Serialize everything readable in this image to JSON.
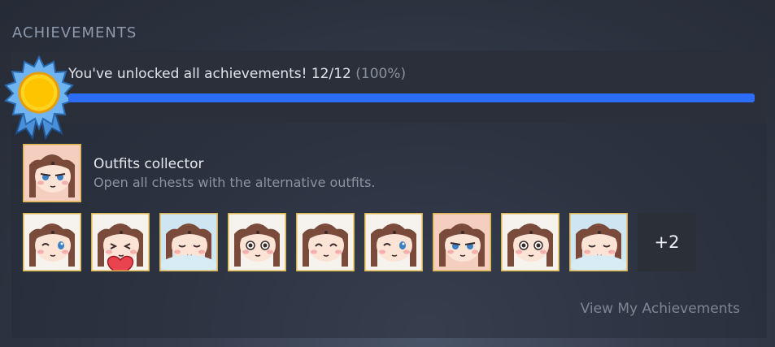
{
  "section_title": "ACHIEVEMENTS",
  "progress": {
    "message": "You've unlocked all achievements! 12/12",
    "percent_text": "(100%)",
    "fraction": 1.0,
    "bar_color": "#2d6cf5",
    "badge_icon": "ribbon-medal-icon"
  },
  "featured": {
    "name": "Outfits collector",
    "description": "Open all chests with the alternative outfits.",
    "icon": "outfits-collector-icon"
  },
  "icons": [
    {
      "name": "achievement-icon-wink",
      "expression": "wink"
    },
    {
      "name": "achievement-icon-heart-blush",
      "expression": "heart"
    },
    {
      "name": "achievement-icon-pillow-sleepy",
      "expression": "pillow"
    },
    {
      "name": "achievement-icon-tearful",
      "expression": "tearful"
    },
    {
      "name": "achievement-icon-happy",
      "expression": "happy"
    },
    {
      "name": "achievement-icon-wink-2",
      "expression": "wink"
    },
    {
      "name": "achievement-icon-smug",
      "expression": "smug"
    },
    {
      "name": "achievement-icon-tearful-2",
      "expression": "tearful"
    },
    {
      "name": "achievement-icon-pillow-2",
      "expression": "pillow"
    }
  ],
  "more_count": "+2",
  "view_link": "View My Achievements",
  "colors": {
    "tile_border": "#d9b24a",
    "hair": "#7a4a3a",
    "skin": "#fbe3d5"
  }
}
